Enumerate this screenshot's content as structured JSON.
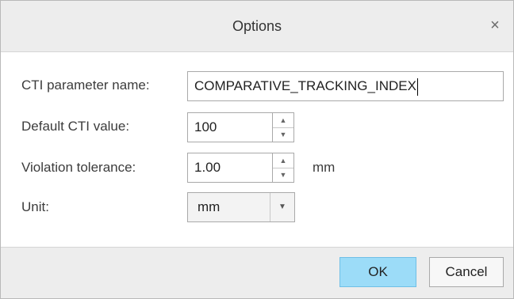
{
  "dialog": {
    "title": "Options",
    "close_glyph": "×"
  },
  "fields": {
    "cti_name": {
      "label": "CTI parameter name:",
      "value": "COMPARATIVE_TRACKING_INDEX"
    },
    "default_cti": {
      "label": "Default CTI value:",
      "value": "100"
    },
    "violation_tolerance": {
      "label": "Violation tolerance:",
      "value": "1.00",
      "unit": "mm"
    },
    "unit": {
      "label": "Unit:",
      "selected": "mm"
    }
  },
  "icons": {
    "spin_up": "▲",
    "spin_down": "▼",
    "dropdown": "▼"
  },
  "buttons": {
    "ok": "OK",
    "cancel": "Cancel"
  },
  "colors": {
    "ok_button": "#9cdcf8",
    "titlebar": "#ededed"
  }
}
